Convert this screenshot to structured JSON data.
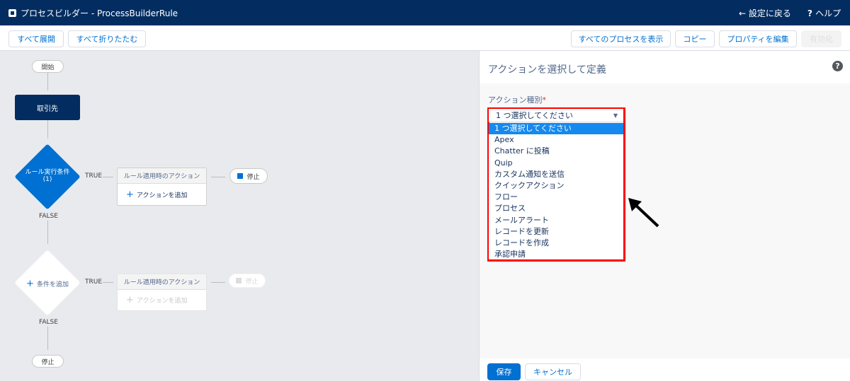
{
  "header": {
    "title": "プロセスビルダー - ProcessBuilderRule",
    "back": "設定に戻る",
    "help": "ヘルプ"
  },
  "toolbar": {
    "expand_all": "すべて展開",
    "collapse_all": "すべて折りたたむ",
    "show_all": "すべてのプロセスを表示",
    "copy": "コピー",
    "edit_props": "プロパティを編集",
    "activate": "有効化"
  },
  "canvas": {
    "start": "開始",
    "object": "取引先",
    "rule1": "ルール実行条件",
    "rule1_num": "(1)",
    "true": "TRUE",
    "false": "FALSE",
    "actions_header": "ルール適用時のアクション",
    "add_action": "アクションを追加",
    "stop": "停止",
    "add_condition": "条件を追加"
  },
  "panel": {
    "title": "アクションを選択して定義",
    "field_label": "アクション種別",
    "required": "*",
    "selected": "1 つ選択してください",
    "options": [
      "1 つ選択してください",
      "Apex",
      "Chatter に投稿",
      "Quip",
      "カスタム通知を送信",
      "クイックアクション",
      "フロー",
      "プロセス",
      "メールアラート",
      "レコードを更新",
      "レコードを作成",
      "承認申請"
    ],
    "save": "保存",
    "cancel": "キャンセル"
  },
  "colors": {
    "navy": "#032d60",
    "brand": "#0070d2",
    "highlight": "#1589ee",
    "annotation": "#ff0000"
  }
}
